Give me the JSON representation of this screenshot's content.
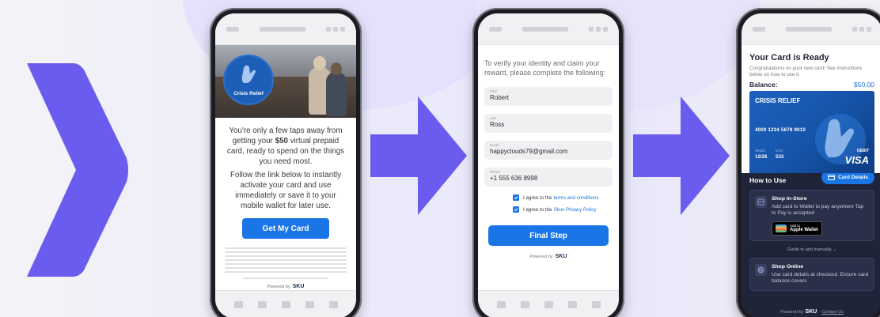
{
  "phone1": {
    "badge_label": "Crisis Relief",
    "text_line_1a": "You're only a few taps away from getting your ",
    "text_amount": "$50",
    "text_line_1b": " virtual prepaid card, ready to spend on the things you need most.",
    "text_line_2": "Follow the link below to instantly activate your card and use immediately or save it to your mobile wallet for later use.",
    "button_label": "Get My Card",
    "powered_by": "Powered by",
    "brand": "SKU"
  },
  "phone2": {
    "intro": "To verify your identity and claim your reward, please complete the following:",
    "fields": [
      {
        "label": "First",
        "value": "Robert"
      },
      {
        "label": "Last",
        "value": "Ross"
      },
      {
        "label": "Email",
        "value": "happyclouds79@gmail.com"
      },
      {
        "label": "Phone",
        "value": "+1 555 636 8998"
      }
    ],
    "agree_1_prefix": "I agree to the",
    "agree_1_link": "terms and conditions",
    "agree_2_prefix": "I agree to the",
    "agree_2_link": "Skux Privacy Policy",
    "button_label": "Final Step",
    "powered_by": "Powered by",
    "brand": "SKU"
  },
  "phone3": {
    "title": "Your Card is Ready",
    "congrats": "Congratulations on your new card! See instructions below on how to use it.",
    "balance_label": "Balance:",
    "balance_value": "$50.00",
    "card": {
      "title": "CRISIS RELIEF",
      "number": "4000 1234 5678 9010",
      "valid_label": "VALID",
      "valid_value": "12/26",
      "cvv_label": "CVV",
      "cvv_value": "533",
      "debit": "DEBIT",
      "network": "VISA"
    },
    "how_to_use": "How to Use",
    "card_details_button": "Card Details",
    "store": {
      "title": "Shop In-Store",
      "body": "Add card to Wallet to pay anywhere Tap to Pay is accepted",
      "wallet_small": "Add to",
      "wallet_big": "Apple Wallet",
      "guide": "Guide to add manually"
    },
    "online": {
      "title": "Shop Online",
      "body": "Use card details at checkout. Ensure card balance covers"
    },
    "footer_powered": "Powered by",
    "footer_brand": "SKU",
    "footer_contact": "Contact Us"
  },
  "colors": {
    "accent": "#1a75e6",
    "purple": "#6b5cf0",
    "dark_panel": "#1f2438"
  }
}
